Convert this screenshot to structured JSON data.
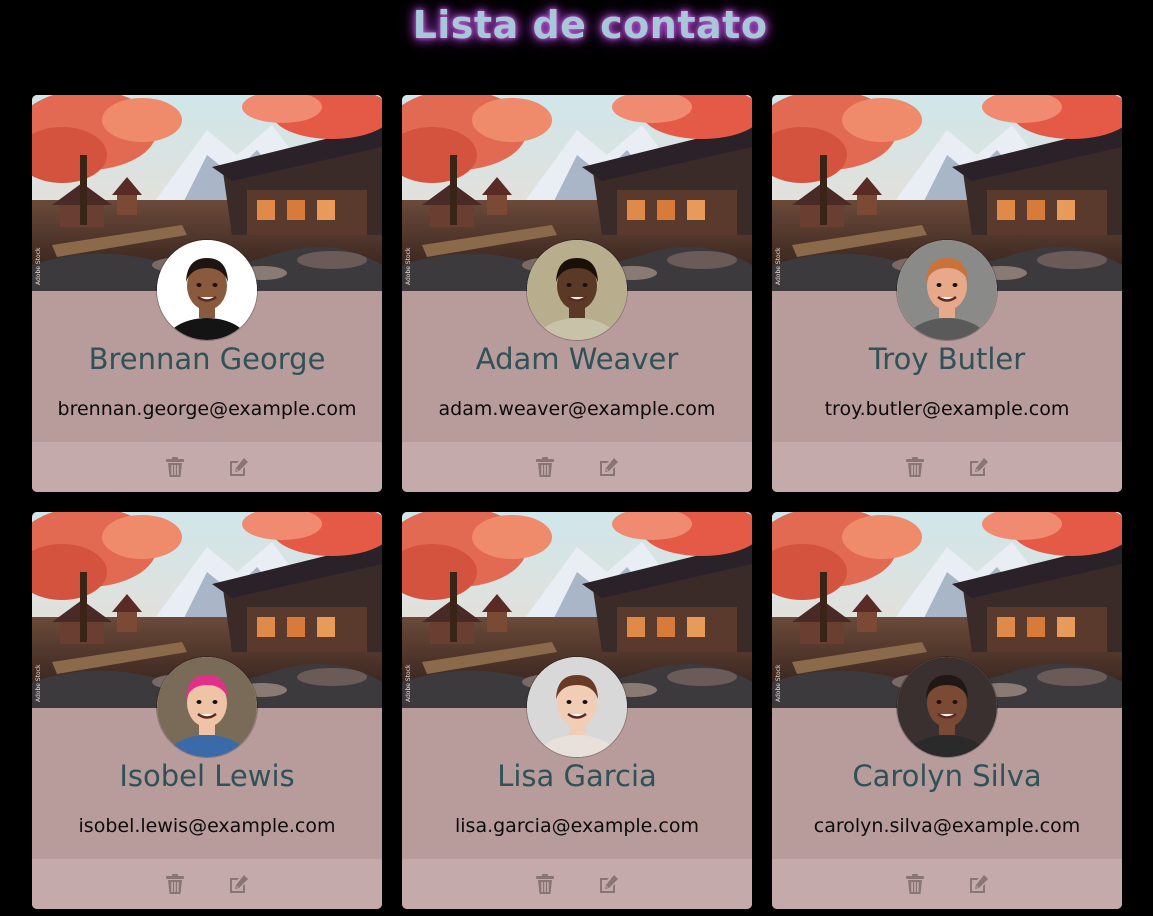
{
  "page": {
    "title": "Lista de contato"
  },
  "contacts": [
    {
      "name": "Brennan George",
      "email": "brennan.george@example.com",
      "avatar": {
        "skin": "#8a5a3c",
        "hair": "#1e1410",
        "shirt": "#141414",
        "bg": "#ffffff"
      }
    },
    {
      "name": "Adam Weaver",
      "email": "adam.weaver@example.com",
      "avatar": {
        "skin": "#5a3a26",
        "hair": "#1a100a",
        "shirt": "#c8c2a8",
        "bg": "#b8ad8c"
      }
    },
    {
      "name": "Troy Butler",
      "email": "troy.butler@example.com",
      "avatar": {
        "skin": "#e8a88a",
        "hair": "#c8733a",
        "shirt": "#5a5a5a",
        "bg": "#8a8a88"
      }
    },
    {
      "name": "Isobel Lewis",
      "email": "isobel.lewis@example.com",
      "avatar": {
        "skin": "#efc3a6",
        "hair": "#e0308a",
        "shirt": "#3b6aa8",
        "bg": "#7a6a58"
      }
    },
    {
      "name": "Lisa Garcia",
      "email": "lisa.garcia@example.com",
      "avatar": {
        "skin": "#f1cdb6",
        "hair": "#6a3a26",
        "shirt": "#e8e0da",
        "bg": "#d8d8d8"
      }
    },
    {
      "name": "Carolyn Silva",
      "email": "carolyn.silva@example.com",
      "avatar": {
        "skin": "#7a4a34",
        "hair": "#201814",
        "shirt": "#2a2a2a",
        "bg": "#3a3030"
      }
    }
  ],
  "icons": {
    "delete": "trash-icon",
    "edit": "edit-icon"
  },
  "colors": {
    "card": "#b89b9b",
    "card_footer": "#c4aaaa",
    "name": "#2f5258",
    "title": "#a7c8d8",
    "title_glow": "#b04bd0",
    "icon": "#8a7575"
  }
}
